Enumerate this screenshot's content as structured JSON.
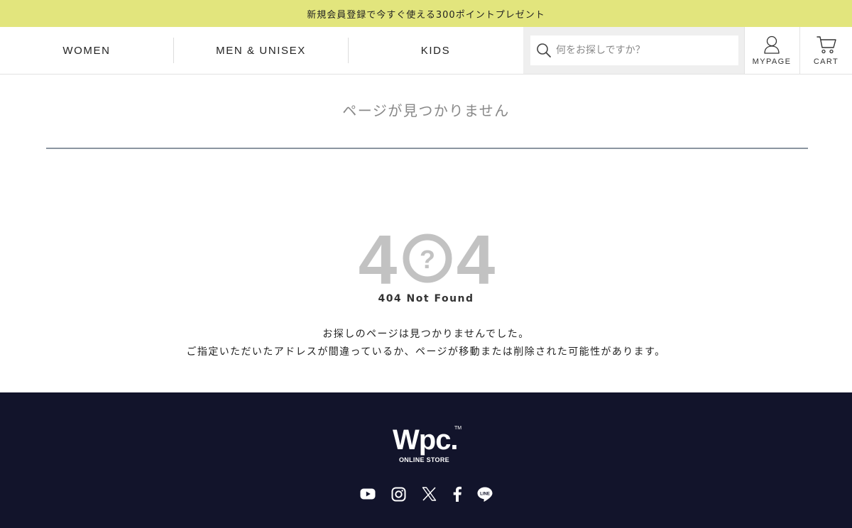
{
  "promo": {
    "text": "新規会員登録で今すぐ使える300ポイントプレゼント"
  },
  "nav": {
    "items": [
      {
        "label": "WOMEN"
      },
      {
        "label": "MEN & UNISEX"
      },
      {
        "label": "KIDS"
      }
    ]
  },
  "search": {
    "placeholder": "何をお探しですか？",
    "icon": "search-icon"
  },
  "account": {
    "mypage_label": "MYPAGE",
    "cart_label": "CART",
    "mypage_icon": "user-icon",
    "cart_icon": "cart-icon"
  },
  "main": {
    "title": "ページが見つかりません",
    "graphic": {
      "left_digit": "4",
      "center_glyph": "?",
      "right_digit": "4"
    },
    "error_label": "404 Not Found",
    "message_line1": "お探しのページは見つかりませんでした。",
    "message_line2": "ご指定いただいたアドレスが間違っているか、ページが移動または削除された可能性があります。"
  },
  "footer": {
    "logo_text": "Wpc.",
    "logo_tm": "TM",
    "logo_sub": "ONLINE STORE",
    "social": [
      "youtube-icon",
      "instagram-icon",
      "x-icon",
      "facebook-icon",
      "line-icon"
    ]
  },
  "colors": {
    "promo_bg": "#e2e57d",
    "footer_bg": "#12142b",
    "graphic_gray": "#c2c2c2",
    "rule": "#8b95a1"
  }
}
